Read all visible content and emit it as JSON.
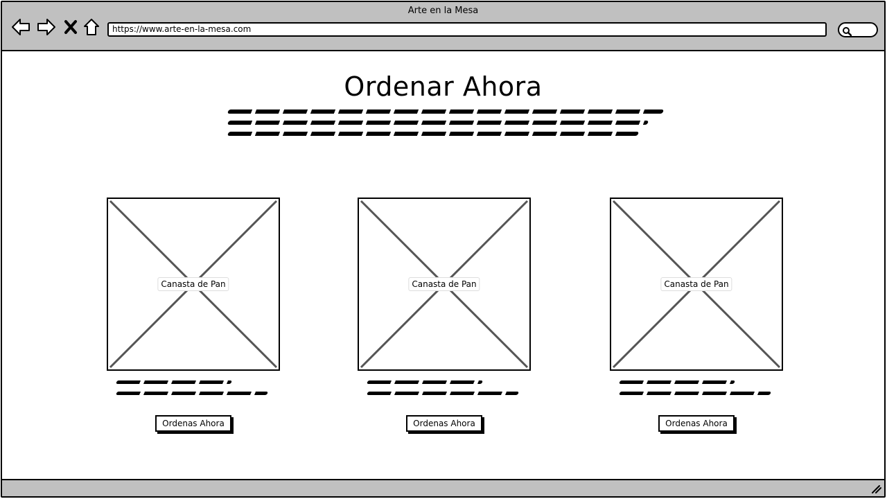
{
  "window": {
    "title": "Arte en la Mesa"
  },
  "browser": {
    "url": "https://www.arte-en-la-mesa.com",
    "nav_icons": [
      "back-arrow-icon",
      "forward-arrow-icon",
      "close-x-icon",
      "home-icon"
    ],
    "search_icon": "search-icon"
  },
  "main": {
    "title": "Ordenar Ahora"
  },
  "products": [
    {
      "image_label": "Canasta de Pan",
      "button_label": "Ordenas Ahora"
    },
    {
      "image_label": "Canasta de Pan",
      "button_label": "Ordenas Ahora"
    },
    {
      "image_label": "Canasta de Pan",
      "button_label": "Ordenas Ahora"
    }
  ],
  "colors": {
    "chrome": "#c0c0c0",
    "border": "#000000",
    "background": "#ffffff"
  }
}
